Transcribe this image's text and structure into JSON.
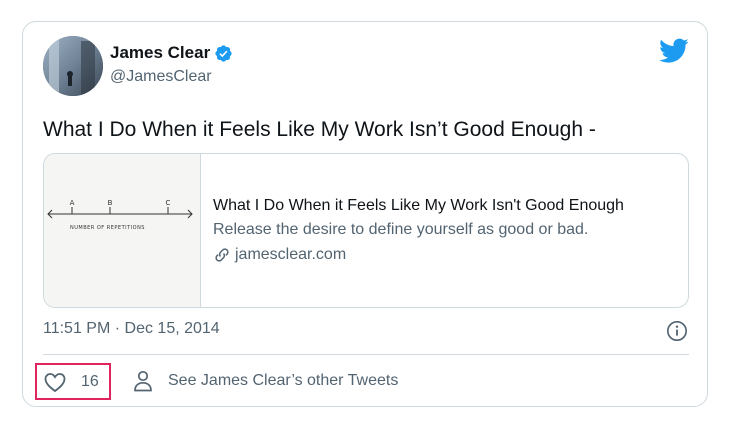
{
  "tweet": {
    "author_name": "James Clear",
    "author_handle": "@JamesClear",
    "text": "What I Do When it Feels Like My Work Isn’t Good Enough -",
    "timestamp": "11:51 PM · Dec 15, 2014"
  },
  "link_card": {
    "title": "What I Do When it Feels Like My Work Isn't Good Enough",
    "description": "Release the desire to define yourself as good or bad.",
    "domain": "jamesclear.com",
    "thumbnail_caption": "NUMBER OF REPETITIONS",
    "thumbnail_marks": [
      "A",
      "B",
      "C"
    ]
  },
  "actions": {
    "like_count": "16",
    "other_tweets_label": "See James Clear’s other Tweets"
  },
  "colors": {
    "verified_blue": "#1d9bf0",
    "twitter_blue": "#1d9bf0",
    "highlight_red": "#e0245e",
    "secondary_text": "#536471"
  },
  "icons": {
    "verified": "verified-badge-icon",
    "brand": "twitter-bird-icon",
    "link": "link-icon",
    "info": "info-icon",
    "like": "heart-icon",
    "profile": "person-icon"
  }
}
